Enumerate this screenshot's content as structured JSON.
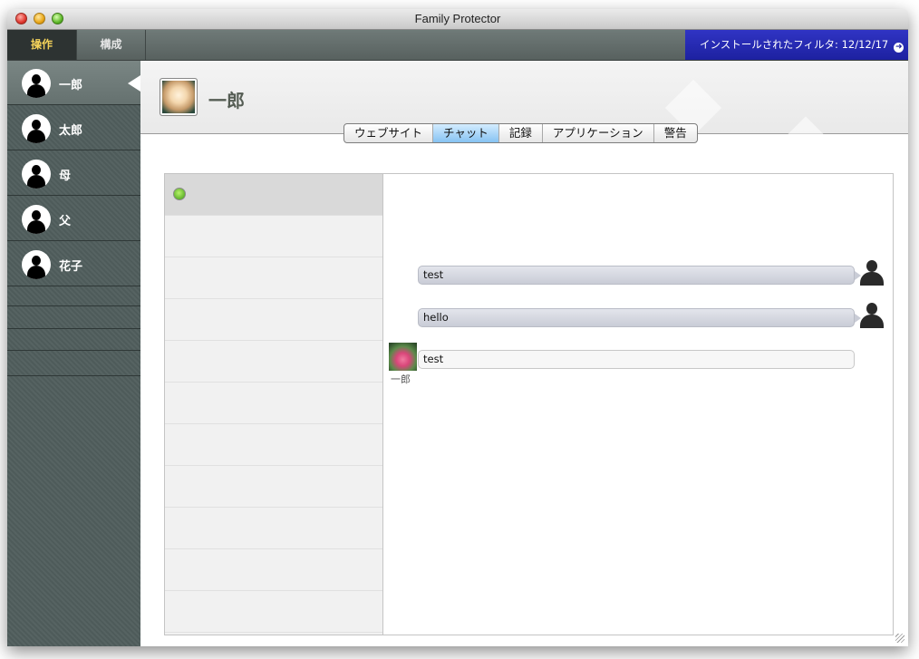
{
  "window": {
    "title": "Family Protector"
  },
  "top_tabs": [
    {
      "label": "操作"
    },
    {
      "label": "構成"
    }
  ],
  "installed_filter": {
    "label": "インストールされたフィルタ: 12/12/17"
  },
  "sidebar": {
    "users": [
      {
        "label": "一郎"
      },
      {
        "label": "太郎"
      },
      {
        "label": "母"
      },
      {
        "label": "父"
      },
      {
        "label": "花子"
      }
    ]
  },
  "profile": {
    "name": "一郎"
  },
  "segments": [
    {
      "label": "ウェブサイト"
    },
    {
      "label": "チャット"
    },
    {
      "label": "記録"
    },
    {
      "label": "アプリケーション"
    },
    {
      "label": "警告"
    }
  ],
  "chat": {
    "messages": [
      {
        "text": "test"
      },
      {
        "text": "hello"
      },
      {
        "text": "test",
        "sender": "一郎"
      }
    ]
  },
  "colors": {
    "active_tab_text": "#f5d35a",
    "filter_banner": "#1d21a0",
    "sidebar_bg": "#566362"
  }
}
